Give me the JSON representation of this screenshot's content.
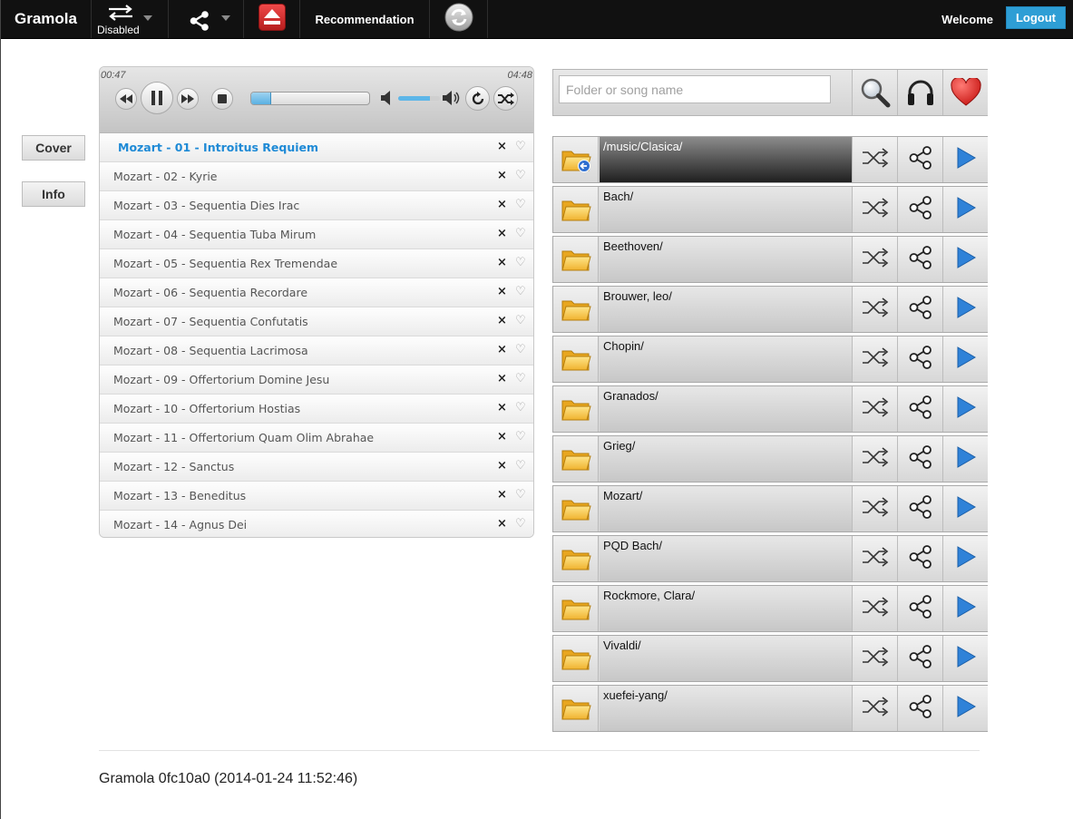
{
  "navbar": {
    "brand": "Gramola",
    "repeat_mode_label": "Disabled",
    "recommendation_label": "Recommendation",
    "welcome_label": "Welcome",
    "logout_label": "Logout"
  },
  "side": {
    "cover_label": "Cover",
    "info_label": "Info"
  },
  "player": {
    "current_time": "00:47",
    "duration": "04:48",
    "progress": 0.17,
    "volume": 0.75
  },
  "playlist": [
    {
      "title": "Mozart - 01 - Introitus Requiem",
      "playing": true
    },
    {
      "title": "Mozart - 02 - Kyrie"
    },
    {
      "title": "Mozart - 03 - Sequentia Dies Irac"
    },
    {
      "title": "Mozart - 04 - Sequentia Tuba Mirum"
    },
    {
      "title": "Mozart - 05 - Sequentia Rex Tremendae"
    },
    {
      "title": "Mozart - 06 - Sequentia Recordare"
    },
    {
      "title": "Mozart - 07 - Sequentia Confutatis"
    },
    {
      "title": "Mozart - 08 - Sequentia Lacrimosa"
    },
    {
      "title": "Mozart - 09 - Offertorium Domine Jesu"
    },
    {
      "title": "Mozart - 10 - Offertorium Hostias"
    },
    {
      "title": "Mozart - 11 - Offertorium Quam Olim Abrahae"
    },
    {
      "title": "Mozart - 12 - Sanctus"
    },
    {
      "title": "Mozart - 13 - Beneditus"
    },
    {
      "title": "Mozart - 14 - Agnus Dei"
    }
  ],
  "track_actions": {
    "remove": "×",
    "love": "♡"
  },
  "search": {
    "placeholder": "Folder or song name"
  },
  "browser": {
    "current_folder": "/music/Clasica/",
    "folders": [
      "Bach/",
      "Beethoven/",
      "Brouwer, leo/",
      "Chopin/",
      "Granados/",
      "Grieg/",
      "Mozart/",
      "PQD Bach/",
      "Rockmore, Clara/",
      "Vivaldi/",
      "xuefei-yang/"
    ]
  },
  "footer": {
    "version_text": "Gramola 0fc10a0 (2014-01-24 11:52:46)"
  },
  "icons": {
    "repeat": "repeat-icon",
    "share": "share-icon",
    "eject": "eject-icon",
    "sync": "sync-icon",
    "rewind": "rewind-icon",
    "pause": "pause-icon",
    "forward": "fast-forward-icon",
    "stop": "stop-icon",
    "volume_down": "volume-down-icon",
    "volume_up": "volume-up-icon",
    "loop": "loop-icon",
    "shuffle": "shuffle-icon",
    "search": "magnifier-icon",
    "headphones": "headphones-icon",
    "heart": "heart-icon",
    "folder": "folder-icon",
    "play": "play-icon"
  },
  "colors": {
    "navbar_bg": "#111111",
    "accent_blue": "#1e8ad6",
    "logout_bg": "#2e9ed5",
    "play_arrow": "#2f82d8",
    "heart_red": "#e0201e",
    "eject_red": "#d42a2a"
  }
}
